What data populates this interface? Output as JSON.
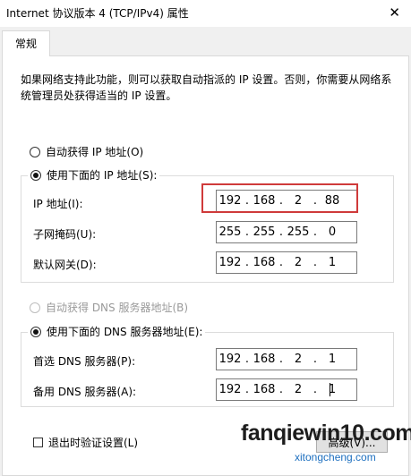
{
  "window": {
    "title": "Internet 协议版本 4 (TCP/IPv4) 属性",
    "close_glyph": "✕"
  },
  "tabs": [
    {
      "label": "常规",
      "selected": true
    }
  ],
  "description": "如果网络支持此功能，则可以获取自动指派的 IP 设置。否则，你需要从网络系统管理员处获得适当的 IP 设置。",
  "ip_section": {
    "auto_option": {
      "label": "自动获得 IP 地址(O)",
      "selected": false
    },
    "manual_option": {
      "label": "使用下面的 IP 地址(S):",
      "selected": true
    },
    "fields": [
      {
        "label": "IP 地址(I):",
        "octets": [
          "192",
          "168",
          "2",
          "88"
        ],
        "highlighted": true
      },
      {
        "label": "子网掩码(U):",
        "octets": [
          "255",
          "255",
          "255",
          "0"
        ]
      },
      {
        "label": "默认网关(D):",
        "octets": [
          "192",
          "168",
          "2",
          "1"
        ]
      }
    ]
  },
  "dns_section": {
    "auto_option": {
      "label": "自动获得 DNS 服务器地址(B)",
      "selected": false,
      "disabled": true
    },
    "manual_option": {
      "label": "使用下面的 DNS 服务器地址(E):",
      "selected": true
    },
    "fields": [
      {
        "label": "首选 DNS 服务器(P):",
        "octets": [
          "192",
          "168",
          "2",
          "1"
        ]
      },
      {
        "label": "备用 DNS 服务器(A):",
        "octets": [
          "192",
          "168",
          "2",
          "1"
        ],
        "focused": true
      }
    ]
  },
  "validate_on_exit": {
    "label": "退出时验证设置(L)",
    "checked": false
  },
  "advanced_button": {
    "label": "高级(V)..."
  },
  "watermark": {
    "main": "fanqiewin10.com",
    "sub": "xitongcheng.com"
  },
  "colors": {
    "highlight": "#cf3a3a",
    "watermark_sub": "#1d6fbf"
  }
}
